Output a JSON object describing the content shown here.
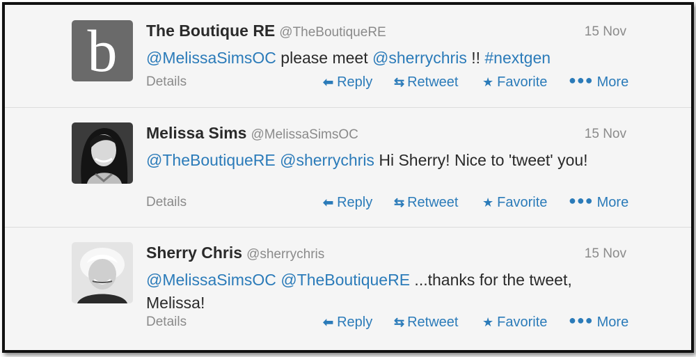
{
  "tweets": [
    {
      "name": "The Boutique RE",
      "handle": "@TheBoutiqueRE",
      "date": "15 Nov",
      "avatar_letter": "b",
      "text_parts": [
        {
          "text": "@MelissaSimsOC",
          "link": true
        },
        {
          "text": " please meet ",
          "link": false
        },
        {
          "text": "@sherrychris",
          "link": true
        },
        {
          "text": " !!  ",
          "link": false
        },
        {
          "text": "#nextgen",
          "link": true
        }
      ]
    },
    {
      "name": "Melissa Sims",
      "handle": "@MelissaSimsOC",
      "date": "15 Nov",
      "text_parts": [
        {
          "text": "@TheBoutiqueRE",
          "link": true
        },
        {
          "text": " ",
          "link": false
        },
        {
          "text": "@sherrychris",
          "link": true
        },
        {
          "text": " Hi Sherry! Nice to 'tweet' you!",
          "link": false
        }
      ]
    },
    {
      "name": "Sherry Chris",
      "handle": "@sherrychris",
      "date": "15 Nov",
      "text_parts": [
        {
          "text": "@MelissaSimsOC",
          "link": true
        },
        {
          "text": " ",
          "link": false
        },
        {
          "text": "@TheBoutiqueRE",
          "link": true
        },
        {
          "text": " ...thanks for the tweet, Melissa!",
          "link": false
        }
      ]
    }
  ],
  "actions": {
    "details": "Details",
    "reply": "Reply",
    "retweet": "Retweet",
    "favorite": "Favorite",
    "more": "More"
  },
  "icons": {
    "reply": "reply-arrow-icon",
    "retweet": "retweet-icon",
    "favorite": "star-icon",
    "more": "ellipsis-icon"
  },
  "colors": {
    "link": "#2b7bb9",
    "text": "#2a2a2a",
    "muted": "#8a8a8a",
    "background": "#f5f5f5",
    "avatar_boutique": "#6a6a6a"
  }
}
